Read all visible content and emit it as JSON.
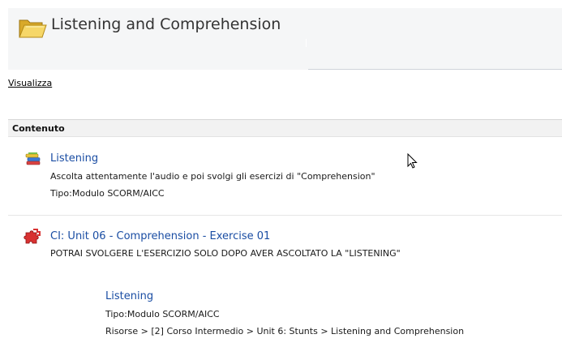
{
  "page": {
    "title": "Listening and Comprehension"
  },
  "nav": {
    "view_link": "Visualizza"
  },
  "content": {
    "section_title": "Contenuto",
    "items": [
      {
        "icon": "books-icon",
        "title": "Listening",
        "description": "Ascolta attentamente l'audio e poi svolgi gli esercizi di \"Comprehension\"",
        "type": "Tipo:Modulo SCORM/AICC"
      },
      {
        "icon": "puzzle-icon",
        "title": "CI: Unit 06 - Comprehension - Exercise 01",
        "description": "POTRAI SVOLGERE L'ESERCIZIO SOLO DOPO AVER ASCOLTATO LA \"LISTENING\"",
        "dependency": {
          "title": "Listening",
          "type": "Tipo:Modulo SCORM/AICC",
          "path": "Risorse > [2] Corso Intermedio > Unit 6: Stunts > Listening and Comprehension"
        }
      }
    ]
  },
  "colors": {
    "link": "#1a4da3",
    "section_bg": "#f2f2f2",
    "header_bg": "#f5f6f7"
  }
}
